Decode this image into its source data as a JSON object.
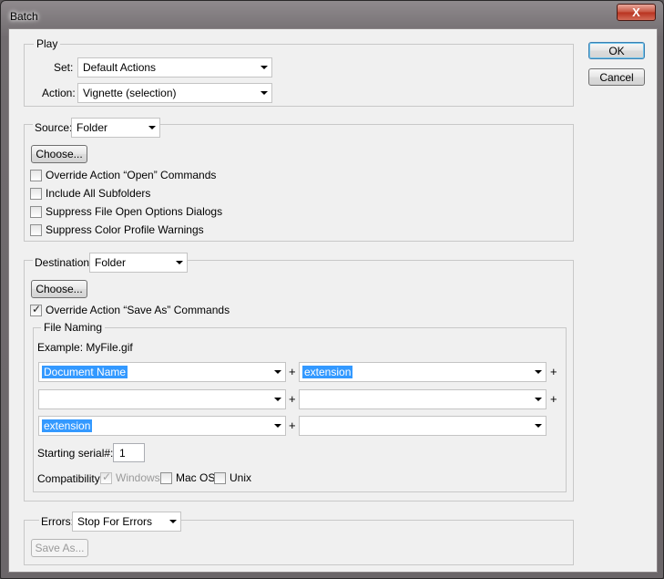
{
  "window": {
    "title": "Batch",
    "close_glyph": "X"
  },
  "buttons": {
    "ok": "OK",
    "cancel": "Cancel"
  },
  "play": {
    "legend": "Play",
    "set_label": "Set:",
    "set_value": "Default Actions",
    "action_label": "Action:",
    "action_value": "Vignette (selection)"
  },
  "source": {
    "label": "Source:",
    "value": "Folder",
    "choose": "Choose...",
    "options": [
      {
        "label": "Override Action “Open” Commands",
        "checked": false
      },
      {
        "label": "Include All Subfolders",
        "checked": false
      },
      {
        "label": "Suppress File Open Options Dialogs",
        "checked": false
      },
      {
        "label": "Suppress Color Profile Warnings",
        "checked": false
      }
    ]
  },
  "destination": {
    "label": "Destination:",
    "value": "Folder",
    "choose": "Choose...",
    "override_label": "Override Action “Save As” Commands",
    "override_checked": true
  },
  "file_naming": {
    "legend": "File Naming",
    "example": "Example: MyFile.gif",
    "fields": [
      "Document Name",
      "extension",
      "",
      "",
      "extension",
      ""
    ],
    "plus": "+",
    "serial_label": "Starting serial#:",
    "serial_value": "1",
    "compat_label": "Compatibility:",
    "compat": [
      {
        "label": "Windows",
        "checked": true,
        "disabled": true
      },
      {
        "label": "Mac OS",
        "checked": false,
        "disabled": false
      },
      {
        "label": "Unix",
        "checked": false,
        "disabled": false
      }
    ]
  },
  "errors": {
    "label": "Errors:",
    "value": "Stop For Errors",
    "save_as": "Save As..."
  }
}
